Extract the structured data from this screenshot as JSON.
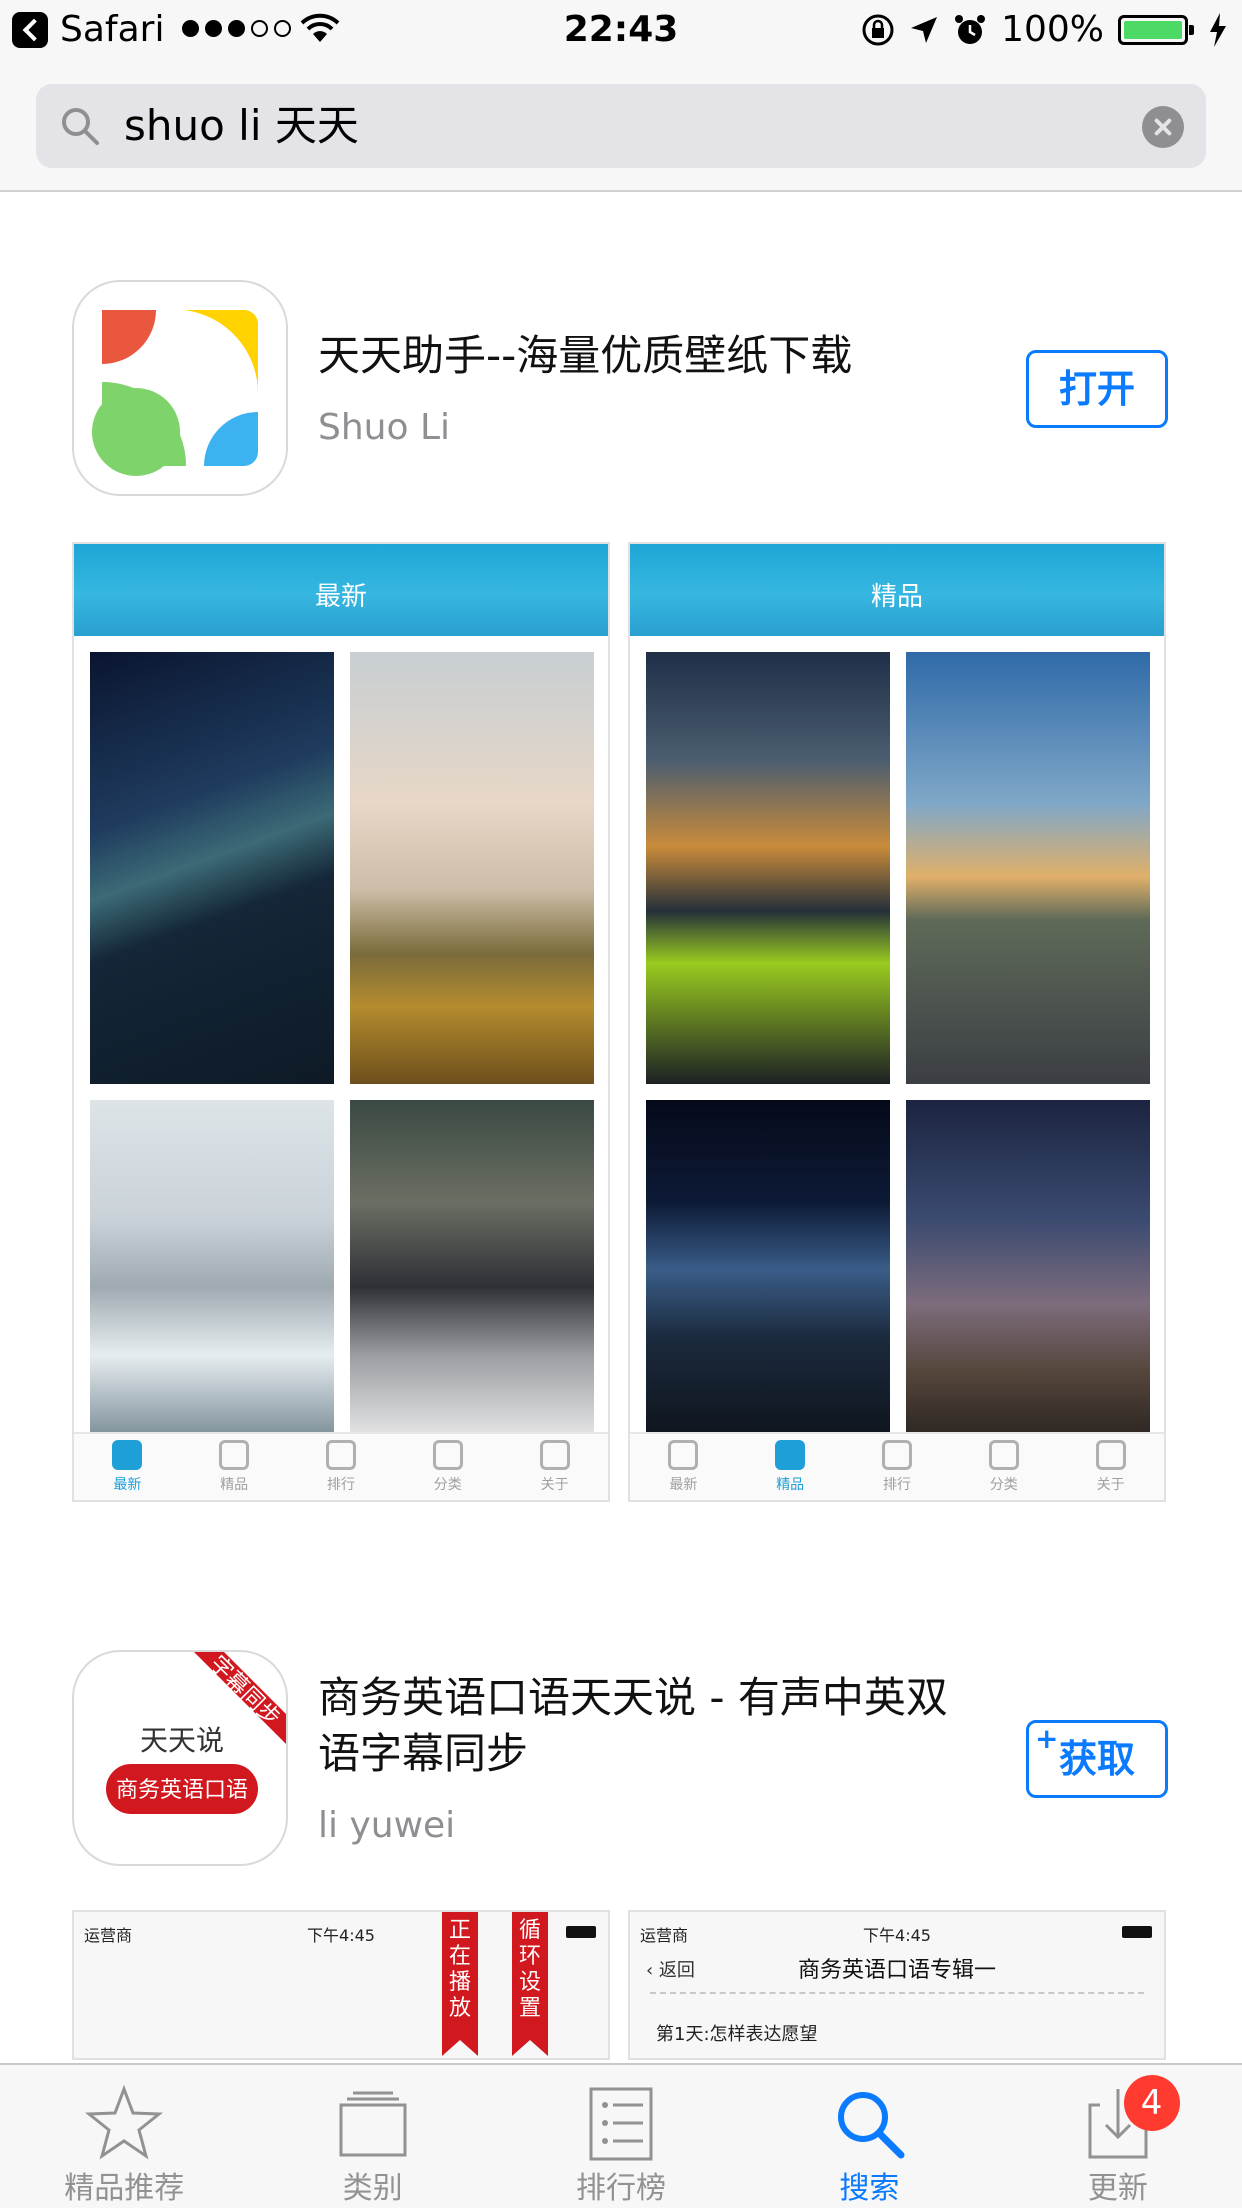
{
  "status_bar": {
    "carrier": "Safari",
    "time": "22:43",
    "battery_percent": "100%",
    "battery_color": "#4cd964",
    "signal_bars_filled": 3,
    "signal_bars_total": 5
  },
  "search": {
    "query": "shuo li 天天",
    "icon": "search-icon",
    "clear_icon": "clear-icon"
  },
  "results": [
    {
      "name": "天天助手--海量优质壁纸下载",
      "developer": "Shuo Li",
      "action": "打开",
      "screenshots": [
        {
          "header": "最新",
          "tabs": [
            "最新",
            "精品",
            "排行",
            "分类",
            "关于"
          ],
          "active_tab": 0
        },
        {
          "header": "精品",
          "tabs": [
            "最新",
            "精品",
            "排行",
            "分类",
            "关于"
          ],
          "active_tab": 1
        }
      ]
    },
    {
      "name": "商务英语口语天天说 - 有声中英双语字幕同步",
      "developer": "li yuwei",
      "action": "获取",
      "action_plus": "+",
      "icon_text_top": "天天说",
      "icon_text_pill": "商务英语口语",
      "icon_ribbon": "字幕同步",
      "screenshots": [
        {
          "carrier": "运营商",
          "time": "下午4:45",
          "ribbon1": "正在播放",
          "ribbon2": "循环设置"
        },
        {
          "carrier": "运营商",
          "time": "下午4:45",
          "back": "返回",
          "title": "商务英语口语专辑一",
          "item": "第1天:怎样表达愿望"
        }
      ]
    }
  ],
  "tabbar": {
    "items": [
      {
        "label": "精品推荐",
        "icon": "star-icon"
      },
      {
        "label": "类别",
        "icon": "categories-icon"
      },
      {
        "label": "排行榜",
        "icon": "ranking-list-icon"
      },
      {
        "label": "搜索",
        "icon": "search-icon",
        "active": true
      },
      {
        "label": "更新",
        "icon": "update-icon",
        "badge": "4"
      }
    ],
    "active_color": "#0a7afe"
  }
}
